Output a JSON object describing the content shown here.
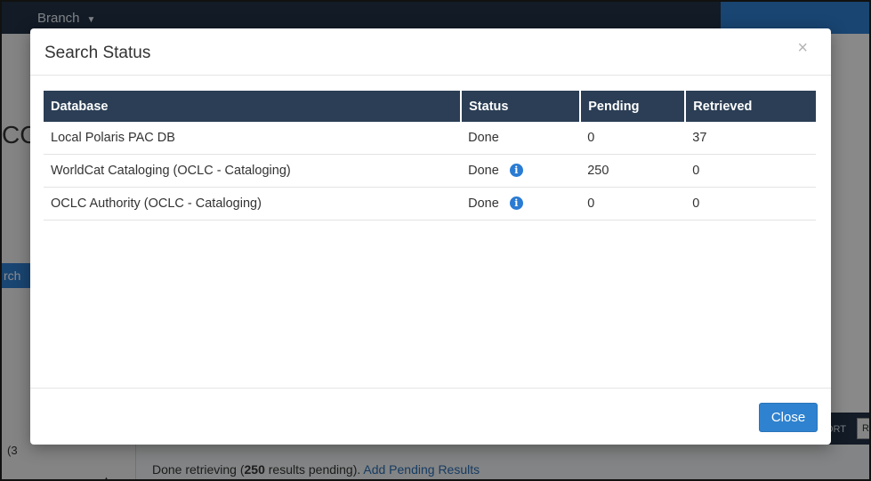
{
  "background": {
    "branch_label": "Branch",
    "left_cc_text": "CC",
    "left_search_text": "rch",
    "left_count_text": "(3",
    "sort_label": "ORT",
    "right_btn_label": "R",
    "status_prefix": "Done retrieving (",
    "status_count": "250",
    "status_suffix": " results pending). ",
    "add_pending_link": "Add Pending Results"
  },
  "modal": {
    "title": "Search Status",
    "close_glyph": "×",
    "close_button_label": "Close",
    "columns": [
      "Database",
      "Status",
      "Pending",
      "Retrieved"
    ],
    "rows": [
      {
        "database": "Local Polaris PAC DB",
        "status": "Done",
        "has_info": false,
        "pending": "0",
        "retrieved": "37"
      },
      {
        "database": "WorldCat Cataloging (OCLC - Cataloging)",
        "status": "Done",
        "has_info": true,
        "pending": "250",
        "retrieved": "0"
      },
      {
        "database": "OCLC Authority (OCLC - Cataloging)",
        "status": "Done",
        "has_info": true,
        "pending": "0",
        "retrieved": "0"
      }
    ]
  },
  "icons": {
    "info": "info-circle-icon",
    "close": "close-icon",
    "caret": "chevron-down-icon"
  },
  "colors": {
    "header_bg": "#2b3e55",
    "primary": "#2f82cf",
    "topbar": "#223245"
  }
}
